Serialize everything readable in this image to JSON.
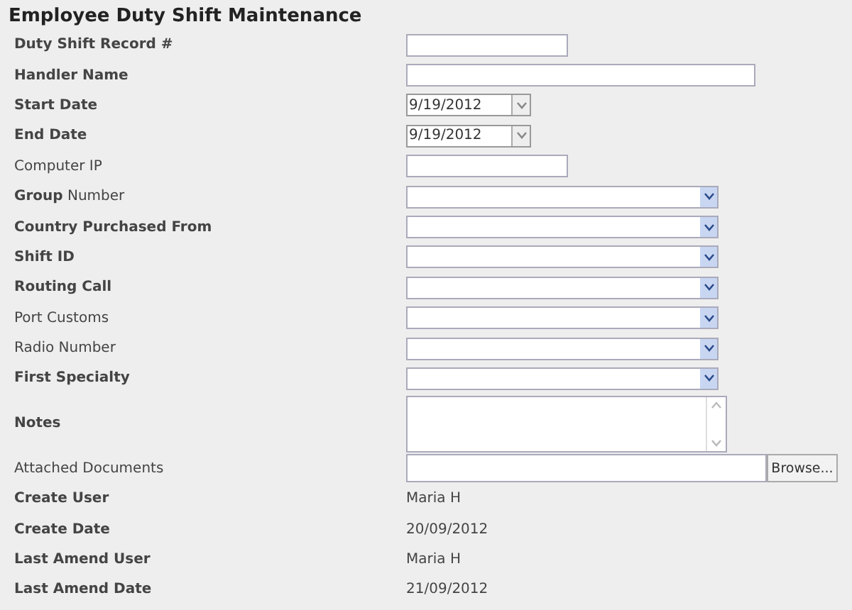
{
  "title": "Employee Duty Shift Maintenance",
  "rows": [
    {
      "label": "Duty Shift Record #",
      "bold": true,
      "kind": "shortfield"
    },
    {
      "label": "Handler Name",
      "bold": true,
      "kind": "longfield"
    },
    {
      "label": "Start Date",
      "bold": true,
      "kind": "date",
      "value": "9/19/2012"
    },
    {
      "label": "End Date",
      "bold": true,
      "kind": "date",
      "value": "9/19/2012"
    },
    {
      "label": "Computer IP",
      "bold": false,
      "kind": "shortfield"
    },
    {
      "label": "**Group** Number",
      "bold": false,
      "kind": "select"
    },
    {
      "label": "Country Purchased From",
      "bold": true,
      "kind": "select"
    },
    {
      "label": "Shift ID",
      "bold": true,
      "kind": "select"
    },
    {
      "label": "Routing Call",
      "bold": true,
      "kind": "select"
    },
    {
      "label": "Port Customs",
      "bold": false,
      "kind": "select"
    },
    {
      "label": "Radio Number",
      "bold": false,
      "kind": "select"
    },
    {
      "label": "First Specialty",
      "bold": true,
      "kind": "select"
    },
    {
      "label": "Notes",
      "bold": true,
      "kind": "textarea"
    },
    {
      "label": "Attached Documents",
      "bold": false,
      "kind": "file",
      "button": "Browse..."
    },
    {
      "label": "Create User",
      "bold": true,
      "kind": "readonly",
      "value": "Maria H"
    },
    {
      "label": "Create Date",
      "bold": true,
      "kind": "readonly",
      "value": "20/09/2012"
    },
    {
      "label": "Last Amend User",
      "bold": true,
      "kind": "readonly",
      "value": "Maria H"
    },
    {
      "label": "Last Amend Date",
      "bold": true,
      "kind": "readonly",
      "value": "21/09/2012"
    }
  ]
}
